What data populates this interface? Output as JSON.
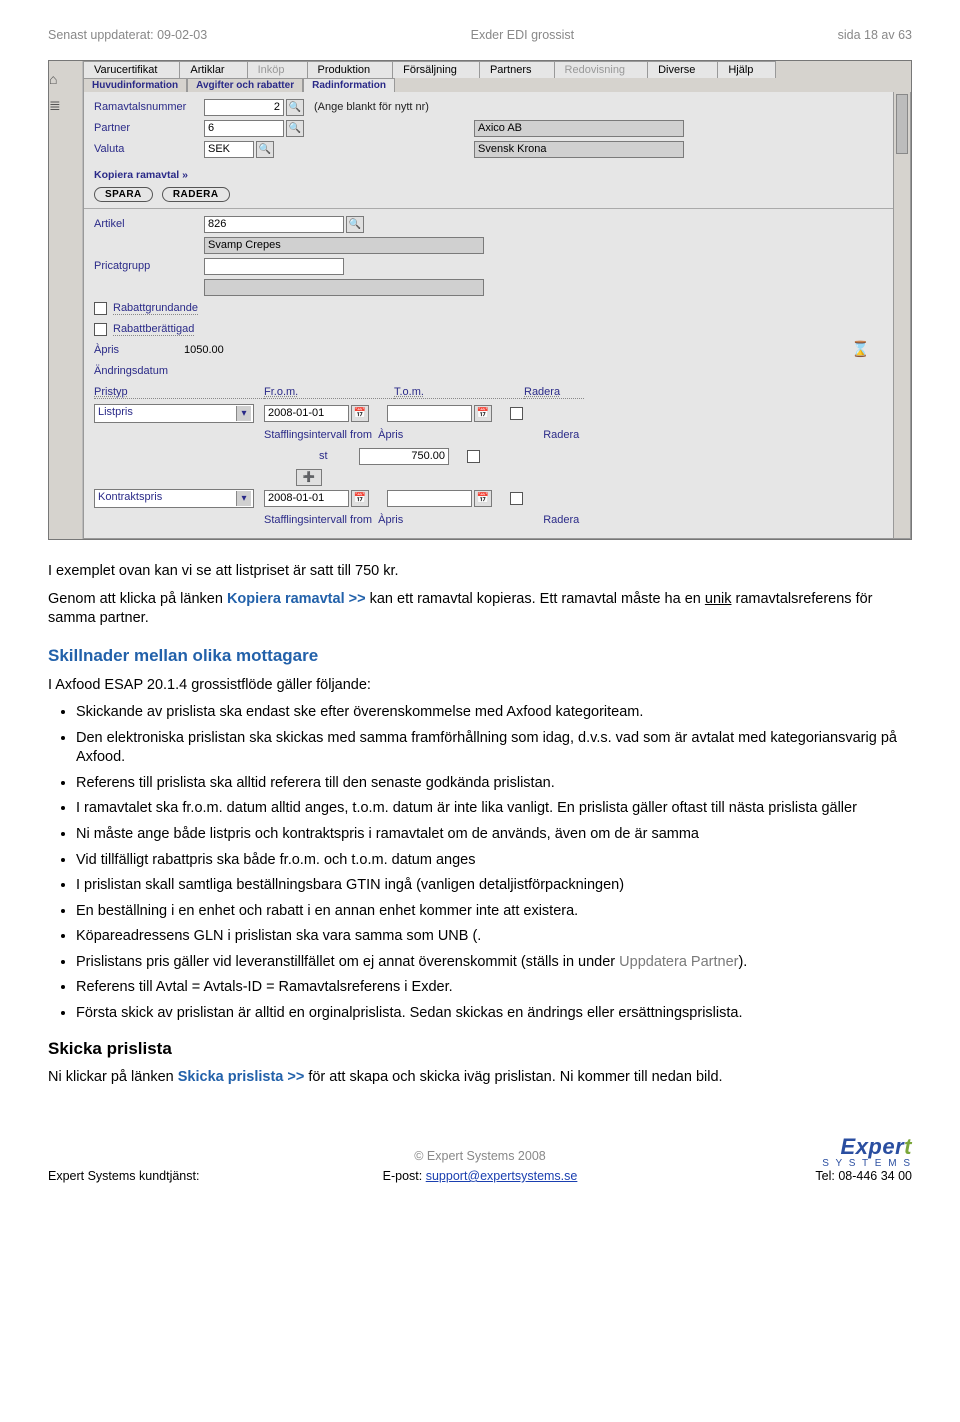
{
  "header": {
    "updated": "Senast uppdaterat: 09-02-03",
    "title": "Exder EDI grossist",
    "page": "sida 18 av 63"
  },
  "app": {
    "menu": [
      "Varucertifikat",
      "Artiklar",
      "Inköp",
      "Produktion",
      "Försäljning",
      "Partners",
      "Redovisning",
      "Diverse",
      "Hjälp"
    ],
    "menu_dim": [
      2,
      6
    ],
    "tabs": [
      "Huvudinformation",
      "Avgifter och rabatter",
      "Radinformation"
    ],
    "active_tab": 2,
    "labels": {
      "ramavtal": "Ramavtalsnummer",
      "partner": "Partner",
      "valuta": "Valuta",
      "artikel": "Artikel",
      "pricatgrupp": "Pricatgrupp",
      "rabattgrundande": "Rabattgrundande",
      "rabattberattigad": "Rabattberättigad",
      "apris": "Àpris",
      "andringsdatum": "Ändringsdatum",
      "pristyp": "Pristyp",
      "from": "Fr.o.m.",
      "tom": "T.o.m.",
      "radera": "Radera",
      "staffling": "Stafflingsintervall from",
      "staffling_apris": "Àpris",
      "st": "st"
    },
    "values": {
      "ramavtal": "2",
      "ramavtal_note": "(Ange blankt för nytt nr)",
      "partner_id": "6",
      "partner_name": "Axico AB",
      "valuta_code": "SEK",
      "valuta_name": "Svensk Krona",
      "artikel": "826",
      "artikel_name": "Svamp Crepes",
      "pricatgrupp": "",
      "pricatgrupp_name": "",
      "apris": "1050.00",
      "pristyp1": "Listpris",
      "from1": "2008-01-01",
      "tom1": "",
      "staff_apris1": "750.00",
      "pristyp2": "Kontraktspris",
      "from2": "2008-01-01",
      "tom2": ""
    },
    "kopiera_link": "Kopiera ramavtal »",
    "spara": "SPARA",
    "radera_btn": "RADERA"
  },
  "content": {
    "p1a": "I exemplet ovan kan vi se att listpriset är satt till 750 kr.",
    "p2a": "Genom att klicka på länken ",
    "p2link": "Kopiera ramavtal >>",
    "p2b": " kan ett ramavtal kopieras. Ett ramavtal måste ha en ",
    "p2u": "unik",
    "p2c": " ramavtalsreferens för samma partner.",
    "h2": "Skillnader mellan olika mottagare",
    "intro": "I Axfood ESAP 20.1.4 grossistflöde gäller följande:",
    "bullets": [
      "Skickande av prislista ska endast ske efter överenskommelse med Axfood kategoriteam.",
      "Den elektroniska prislistan ska skickas med samma framförhållning som idag, d.v.s. vad som är avtalat med kategoriansvarig på Axfood.",
      "Referens till prislista ska alltid referera till den senaste godkända prislistan.",
      "I ramavtalet ska fr.o.m. datum alltid anges, t.o.m. datum är inte lika vanligt. En prislista gäller oftast till nästa prislista gäller",
      "Ni måste ange både listpris och kontraktspris i ramavtalet om de används, även om de är samma",
      "Vid tillfälligt rabattpris ska både fr.o.m. och t.o.m. datum anges",
      "I prislistan skall samtliga beställningsbara GTIN ingå (vanligen detaljistförpackningen)",
      "En beställning i en enhet och rabatt i en annan enhet kommer inte att existera.",
      "Köpareadressens GLN i prislistan ska vara samma som UNB (.",
      "",
      "Referens till Avtal = Avtals-ID = Ramavtalsreferens i Exder.",
      "Första skick av prislistan är alltid en orginalprislista. Sedan skickas en ändrings eller ersättningsprislista."
    ],
    "bullet10a": "Prislistans pris gäller vid leveranstillfället om ej annat överenskommit (ställs in under ",
    "bullet10b": "Uppdatera Partner",
    "bullet10c": ").",
    "h3": "Skicka prislista",
    "p3a": "Ni klickar på länken ",
    "p3link": "Skicka prislista >>",
    "p3b": " för att skapa och skicka iväg prislistan. Ni kommer till nedan bild."
  },
  "footer": {
    "copyright": "© Expert Systems 2008",
    "left": "Expert Systems kundtjänst:",
    "center_label": "E-post: ",
    "center_link": "support@expertsystems.se",
    "right": "Tel: 08-446 34 00",
    "logo_main": "Exper",
    "logo_t": "t",
    "logo_sub": "S Y S T E M S"
  }
}
